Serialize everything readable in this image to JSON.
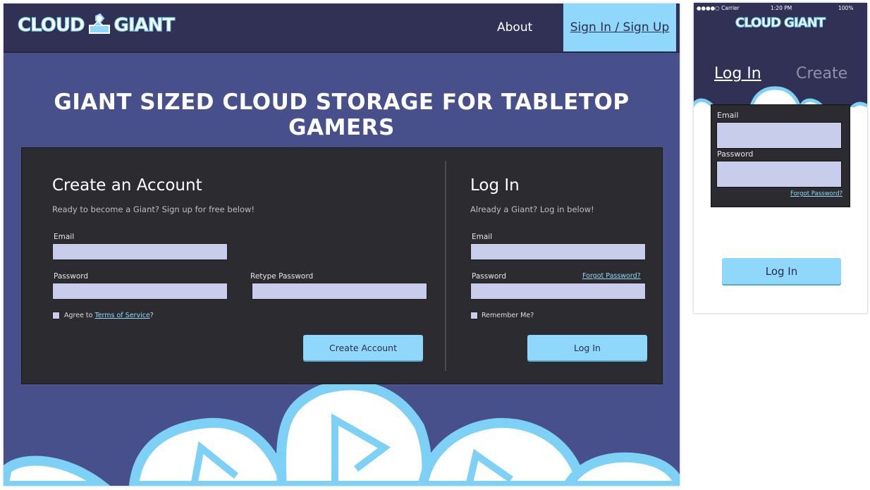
{
  "desktop": {
    "logo_text_left": "CLOUD",
    "logo_text_right": "GIANT",
    "nav": {
      "about": "About",
      "signin": "Sign In / Sign Up"
    },
    "hero_title": "GIANT SIZED CLOUD STORAGE FOR TABLETOP GAMERS",
    "create": {
      "title": "Create an Account",
      "subtitle": "Ready to become a Giant? Sign up for free below!",
      "email_label": "Email",
      "password_label": "Password",
      "retype_label": "Retype Password",
      "agree_prefix": "Agree to ",
      "terms_link": "Terms of Service",
      "agree_suffix": "?",
      "button": "Create Account"
    },
    "login": {
      "title": "Log In",
      "subtitle": "Already a Giant? Log in below!",
      "email_label": "Email",
      "password_label": "Password",
      "forgot": "Forgot Password?",
      "remember": "Remember Me?",
      "button": "Log In"
    }
  },
  "mobile": {
    "status": {
      "carrier": "●●●●○ Carrier",
      "time": "1:20 PM",
      "battery": "100%"
    },
    "logo_text": "CLOUD GIANT",
    "tab_login": "Log In",
    "tab_create": "Create",
    "email_label": "Email",
    "password_label": "Password",
    "forgot": "Forgot Password?",
    "button": "Log In"
  },
  "colors": {
    "nav": "#313156",
    "page": "#48508b",
    "panel": "#2c2c30",
    "accent": "#8fd8fb",
    "input": "#c8cdec"
  }
}
